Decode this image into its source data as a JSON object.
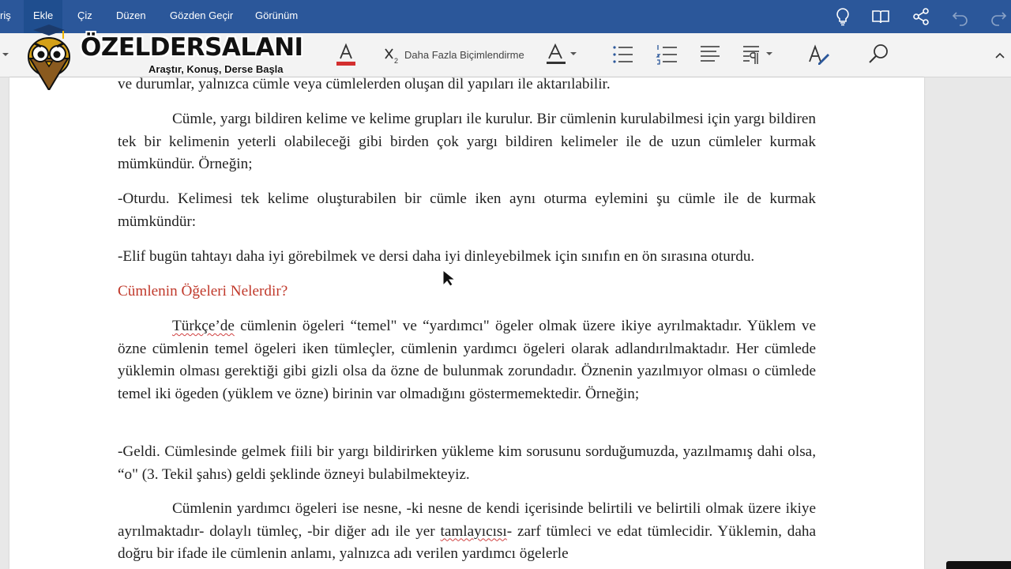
{
  "ribbon": {
    "tabs": [
      {
        "label": "riş"
      },
      {
        "label": "Ekle"
      },
      {
        "label": "Çiz"
      },
      {
        "label": "Düzen"
      },
      {
        "label": "Gözden Geçir"
      },
      {
        "label": "Görünüm"
      }
    ],
    "active_tab": "Ekle",
    "right_icons": [
      "lightbulb-icon",
      "book-icon",
      "share-icon",
      "undo-icon",
      "redo-icon"
    ],
    "accent_color": "#2b579a"
  },
  "toolbar": {
    "subscript_label": "Daha Fazla Biçimlendirme",
    "font_color": "#d32f2f",
    "icons": [
      "font-color-icon",
      "subscript-icon",
      "text-style-icon",
      "bullet-list-icon",
      "numbered-list-icon",
      "align-icon",
      "paragraph-icon",
      "styles-icon",
      "search-icon",
      "collapse-icon"
    ]
  },
  "watermark": {
    "title": "ÖZELDERSALANI",
    "subtitle": "Araştır, Konuş, Derse Başla"
  },
  "document": {
    "para1": "ve durumlar, yalnızca cümle veya cümlelerden oluşan dil yapıları ile aktarılabilir.",
    "para2": "Cümle, yargı bildiren kelime ve kelime grupları ile kurulur. Bir cümlenin kurulabilmesi için yargı bildiren tek bir kelimenin yeterli olabileceği gibi birden çok yargı bildiren kelimeler ile de uzun cümleler kurmak mümkündür. Örneğin;",
    "para3": "-Oturdu. Kelimesi tek kelime oluşturabilen bir cümle iken aynı oturma eylemini şu cümle ile de kurmak mümkündür:",
    "para4": "-Elif bugün tahtayı daha iyi görebilmek ve dersi daha iyi dinleyebilmek için sınıfın en ön sırasına oturdu.",
    "heading": "Cümlenin Öğeleri Nelerdir?",
    "para5_word": "Türkçe’de",
    "para5_rest": " cümlenin ögeleri “temel\" ve “yardımcı\" ögeler olmak üzere ikiye ayrılmaktadır. Yüklem ve özne cümlenin temel ögeleri iken tümleçler, cümlenin yardımcı ögeleri olarak adlandırılmaktadır. Her cümlede yüklemin olması gerektiği gibi gizli olsa da özne de bulunmak zorundadır. Öznenin yazılmıyor olması o cümlede temel iki ögeden (yüklem ve özne) birinin var olmadığını göstermemektedir. Örneğin;",
    "para6": "-Geldi. Cümlesinde gelmek fiili bir yargı bildirirken yükleme kim sorusunu sorduğumuzda, yazılmamış dahi olsa, “o\" (3. Tekil şahıs) geldi şeklinde özneyi bulabilmekteyiz.",
    "para7_a": "Cümlenin yardımcı ögeleri ise nesne, -ki nesne de kendi içerisinde belirtili ve belirtili olmak üzere ikiye ayrılmaktadır- dolaylı tümleç, -bir diğer adı ile yer ",
    "para7_word": "tamlayıcısı",
    "para7_b": "- zarf tümleci ve edat tümlecidir. Yüklemin, daha doğru bir ifade ile cümlenin anlamı, yalnızca adı verilen yardımcı ögelerle",
    "heading_color": "#c0392b"
  }
}
